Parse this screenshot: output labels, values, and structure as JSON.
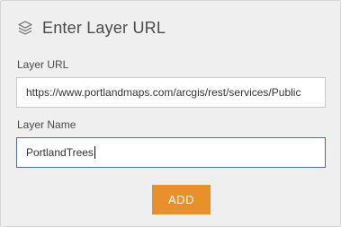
{
  "header": {
    "icon": "layers-icon",
    "title": "Enter Layer URL"
  },
  "form": {
    "layer_url": {
      "label": "Layer URL",
      "value": "https://www.portlandmaps.com/arcgis/rest/services/Public"
    },
    "layer_name": {
      "label": "Layer Name",
      "value": "PortlandTrees"
    },
    "add_label": "ADD"
  },
  "colors": {
    "panel_background": "#efefef",
    "accent_button": "#e8902c",
    "focused_border": "#4f6ea0"
  }
}
